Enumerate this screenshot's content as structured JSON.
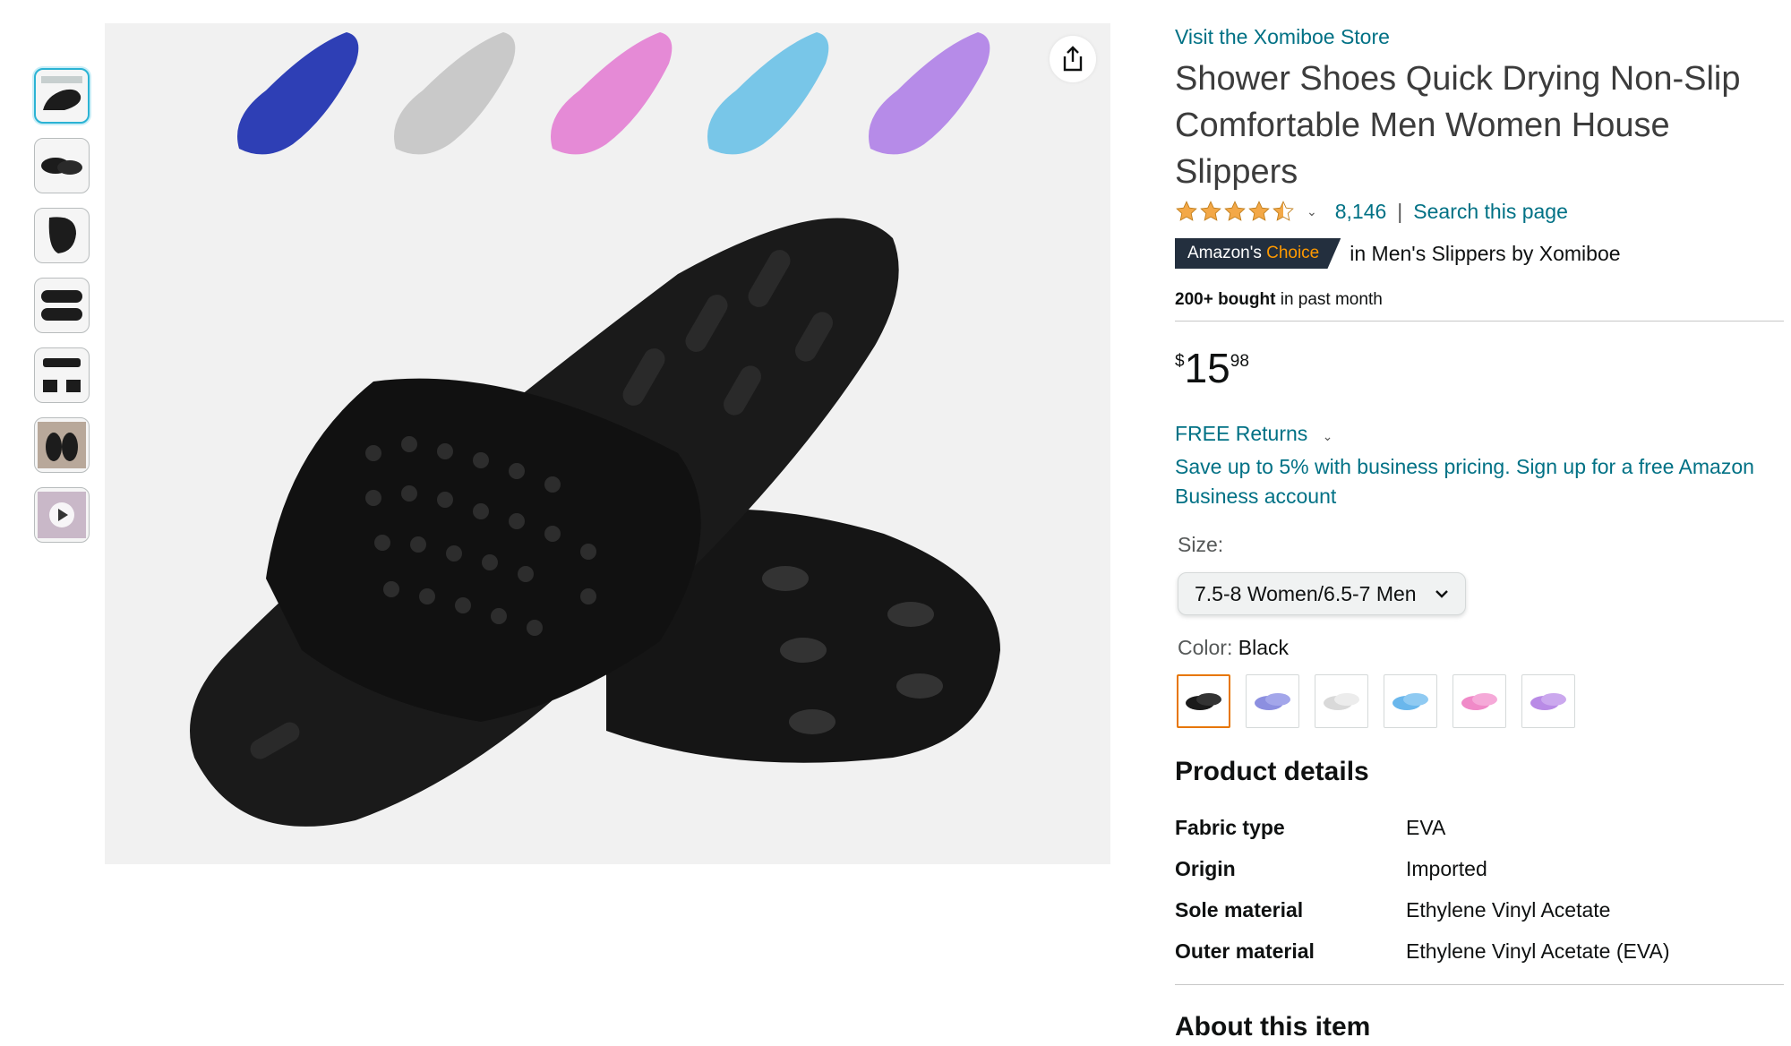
{
  "store_link": "Visit the Xomiboe Store",
  "title": "Shower Shoes Quick Drying Non-Slip Comfortable Men Women House Slippers",
  "rating": {
    "stars": 4.5,
    "count": "8,146",
    "search_link": "Search this page"
  },
  "badge": {
    "prefix": "Amazon's",
    "suffix": "Choice",
    "context": "in Men's Slippers by Xomiboe"
  },
  "bought": {
    "bold": "200+ bought",
    "rest": "in past month"
  },
  "price": {
    "symbol": "$",
    "whole": "15",
    "fraction": "98"
  },
  "free_returns": "FREE Returns",
  "business_offer": "Save up to 5% with business pricing. Sign up for a free Amazon Business account",
  "size": {
    "label": "Size:",
    "selected": "7.5-8 Women/6.5-7 Men"
  },
  "color": {
    "label": "Color:",
    "selected": "Black",
    "swatches": [
      "#1a1a1a",
      "#8c8fe0",
      "#d9d9d9",
      "#6ab7ec",
      "#f08ac8",
      "#b98be6"
    ]
  },
  "product_details": {
    "title": "Product details",
    "rows": [
      {
        "key": "Fabric type",
        "value": "EVA"
      },
      {
        "key": "Origin",
        "value": "Imported"
      },
      {
        "key": "Sole material",
        "value": "Ethylene Vinyl Acetate"
      },
      {
        "key": "Outer material",
        "value": "Ethylene Vinyl Acetate (EVA)"
      }
    ]
  },
  "about_title": "About this item",
  "main_image": {
    "hero_color": "#1c1c1c",
    "variant_colors": [
      "#2e3fb5",
      "#c9c9c9",
      "#e58ad6",
      "#78c6e8",
      "#b68be8"
    ]
  },
  "icons": {
    "share": "share-icon",
    "star": "star-icon",
    "chevron": "chevron-down-icon",
    "play": "play-icon"
  },
  "colors": {
    "link": "#007185",
    "badge_bg": "#232f3e",
    "badge_accent": "#ff9900",
    "star": "#f3a847"
  }
}
